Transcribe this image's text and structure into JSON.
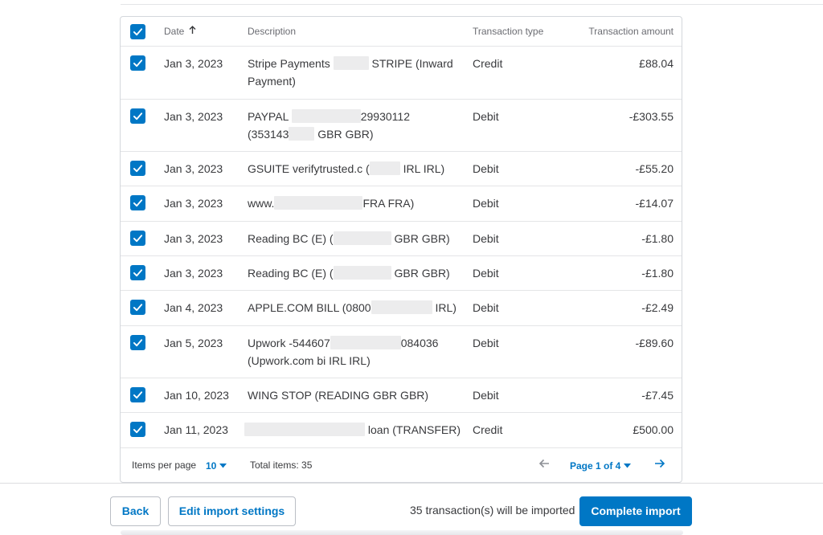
{
  "table": {
    "headers": {
      "date": "Date",
      "description": "Description",
      "type": "Transaction type",
      "amount": "Transaction amount"
    },
    "rows": [
      {
        "date": "Jan 3, 2023",
        "desc1_pre": "Stripe Payments",
        "desc1_post": "STRIPE (Inward",
        "desc2": "Payment)",
        "type": "Credit",
        "amount": "£88.04"
      },
      {
        "date": "Jan 3, 2023",
        "desc1_pre": "PAYPAL",
        "desc1_post": "29930112",
        "desc2_pre": "(353143",
        "desc2_post": "GBR GBR)",
        "type": "Debit",
        "amount": "-£303.55"
      },
      {
        "date": "Jan 3, 2023",
        "desc1_pre": "GSUITE verifytrusted.c (",
        "desc1_post": "IRL IRL)",
        "type": "Debit",
        "amount": "-£55.20"
      },
      {
        "date": "Jan 3, 2023",
        "desc1_pre": "www.",
        "desc1_post": "FRA FRA)",
        "type": "Debit",
        "amount": "-£14.07"
      },
      {
        "date": "Jan 3, 2023",
        "desc1_pre": "Reading BC (E) (",
        "desc1_post": "GBR GBR)",
        "type": "Debit",
        "amount": "-£1.80"
      },
      {
        "date": "Jan 3, 2023",
        "desc1_pre": "Reading BC (E) (",
        "desc1_post": "GBR GBR)",
        "type": "Debit",
        "amount": "-£1.80"
      },
      {
        "date": "Jan 4, 2023",
        "desc1_pre": "APPLE.COM BILL (0800",
        "desc1_post": "IRL)",
        "type": "Debit",
        "amount": "-£2.49"
      },
      {
        "date": "Jan 5, 2023",
        "desc1_pre": "Upwork -544607",
        "desc1_post": "084036",
        "desc2": "(Upwork.com bi IRL IRL)",
        "type": "Debit",
        "amount": "-£89.60"
      },
      {
        "date": "Jan 10, 2023",
        "desc1_pre": "WING STOP (READING GBR GBR)",
        "type": "Debit",
        "amount": "-£7.45"
      },
      {
        "date": "Jan 11, 2023",
        "desc1_post": "loan (TRANSFER)",
        "type": "Credit",
        "amount": "£500.00"
      }
    ]
  },
  "pagination": {
    "items_per_page_label": "Items per page",
    "items_per_page_value": "10",
    "total_items": "Total items: 35",
    "page_label": "Page 1 of 4"
  },
  "footer": {
    "back_label": "Back",
    "edit_settings_label": "Edit import settings",
    "import_message": "35 transaction(s) will be imported",
    "complete_label": "Complete import"
  },
  "colors": {
    "accent": "#0077c5",
    "text": "#393a3d",
    "muted": "#6b6c72",
    "border": "#d4d7dc"
  }
}
